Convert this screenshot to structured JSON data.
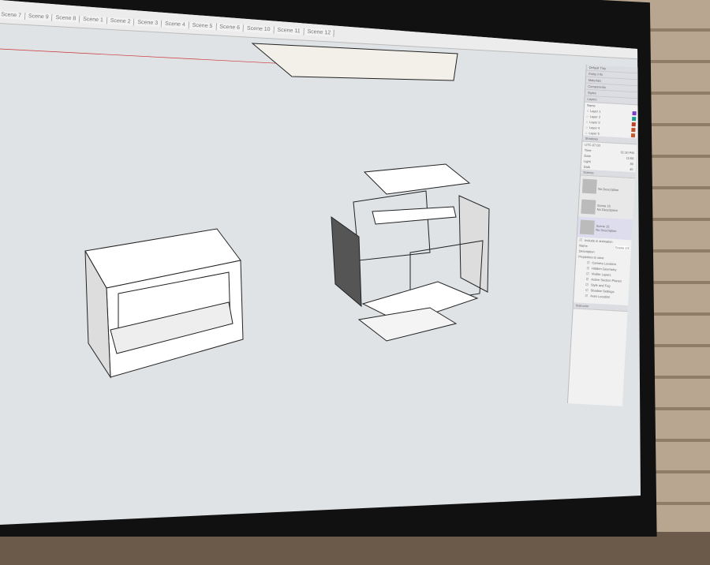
{
  "scenes": [
    "Scene 7",
    "Scene 9",
    "Scene 8",
    "Scene 1",
    "Scene 2",
    "Scene 3",
    "Scene 4",
    "Scene 5",
    "Scene 6",
    "Scene 10",
    "Scene 11",
    "Scene 12"
  ],
  "tray": {
    "title": "Default Tray",
    "panels": [
      "Entity Info",
      "Materials",
      "Components",
      "Styles",
      "Layers"
    ],
    "layers_header": "Name",
    "layers": [
      {
        "name": "Layer 1",
        "color": "#7b3fc4"
      },
      {
        "name": "Layer 2",
        "color": "#1a9a8a"
      },
      {
        "name": "Layer 3",
        "color": "#b8452a"
      },
      {
        "name": "Layer 4",
        "color": "#c0502a"
      },
      {
        "name": "Layer 5",
        "color": "#c85a30"
      }
    ],
    "shadows": {
      "title": "Shadows",
      "utc": "UTC-07:00",
      "time_label": "Time",
      "time_value": "01:30 PM",
      "date_label": "Date",
      "date_value": "11/08",
      "light_label": "Light",
      "light_value": "80",
      "dark_label": "Dark",
      "dark_value": "45"
    },
    "scenes_panel": {
      "title": "Scenes",
      "items": [
        {
          "name": "",
          "desc": "No Description"
        },
        {
          "name": "Scene 16",
          "desc": "No Description"
        },
        {
          "name": "Scene 15",
          "desc": "No Description"
        }
      ],
      "include": "Include in animation",
      "name_label": "Name",
      "name_value": "Scene 13",
      "desc_label": "Description",
      "props_label": "Properties to save",
      "props": [
        "Camera Location",
        "Hidden Geometry",
        "Visible Layers",
        "Active Section Planes",
        "Style and Fog",
        "Shadow Settings",
        "Axes Location"
      ]
    },
    "instructor": "Instructor"
  }
}
